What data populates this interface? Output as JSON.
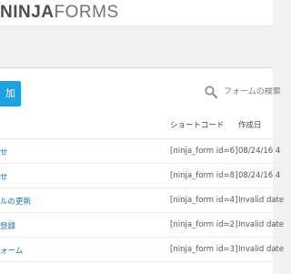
{
  "header": {
    "logo_bold": "NINJA",
    "logo_light": "FORMS"
  },
  "toolbar": {
    "add_button_label": "加",
    "search_placeholder": "フォームの検索",
    "search_icon": "magnifier-icon"
  },
  "table": {
    "columns": {
      "shortcode": "ショートコード",
      "created": "作成日"
    },
    "rows": [
      {
        "title": "せ",
        "shortcode": "[ninja_form id=6]",
        "date": "08/24/16 4"
      },
      {
        "title": "せ",
        "shortcode": "[ninja_form id=8]",
        "date": "08/24/16 4"
      },
      {
        "title": "ルの更新",
        "shortcode": "[ninja_form id=4]",
        "date": "Invalid date"
      },
      {
        "title": "登録",
        "shortcode": "[ninja_form id=2]",
        "date": "Invalid date"
      },
      {
        "title": "ォーム",
        "shortcode": "[ninja_form id=3]",
        "date": "Invalid date"
      }
    ]
  },
  "colors": {
    "accent": "#1ea1e1",
    "link": "#2271b1"
  }
}
